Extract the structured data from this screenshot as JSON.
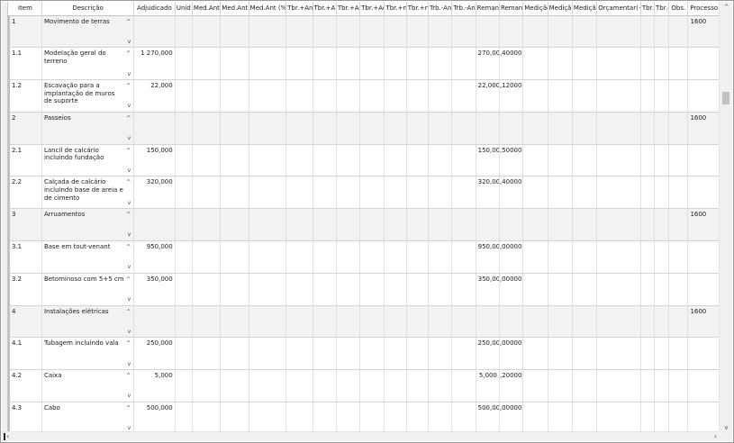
{
  "columns": [
    "Item",
    "Descrição",
    "Adjudicado",
    "Unid",
    "Med.Ant",
    "Med.Ant",
    "Med.Ant (%)",
    "Tbr.+Ant",
    "Tbr.+An",
    "Tbr.+Ad",
    "Tbr.+Ad",
    "Tbr.+n./",
    "Tbr.+n./",
    "Trb.-Ant",
    "Trb.-Ant",
    "Remane",
    "Remane",
    "Medição",
    "Medição",
    "Medição",
    "Orçamentar(+)",
    "Tbr.+",
    "Tbr.-",
    "Obs.",
    "Processo"
  ],
  "rows": [
    {
      "item": "1",
      "descricao": "Movimento de terras",
      "adjudicado": "",
      "remane1": "",
      "remane2": "",
      "processo": "1600",
      "group": true
    },
    {
      "item": "1.1",
      "descricao": "Modelação geral do terreno",
      "adjudicado": "1 270,000",
      "remane1": "270,000",
      "remane2": ",400000",
      "processo": "",
      "group": false
    },
    {
      "item": "1.2",
      "descricao": "Escavação para a implantação de muros de suporte",
      "adjudicado": "22,000",
      "remane1": "22,000",
      "remane2": ",120000",
      "processo": "",
      "group": false
    },
    {
      "item": "2",
      "descricao": "Passeios",
      "adjudicado": "",
      "remane1": "",
      "remane2": "",
      "processo": "1600",
      "group": true
    },
    {
      "item": "2.1",
      "descricao": "Lancil de calcário incluindo fundação",
      "adjudicado": "150,000",
      "remane1": "150,000",
      "remane2": ",500000",
      "processo": "",
      "group": false
    },
    {
      "item": "2.2",
      "descricao": "Calçada de calcário incluindo base de areia e de cimento",
      "adjudicado": "320,000",
      "remane1": "320,000",
      "remane2": ",400000",
      "processo": "",
      "group": false
    },
    {
      "item": "3",
      "descricao": "Arruamentos",
      "adjudicado": "",
      "remane1": "",
      "remane2": "",
      "processo": "1600",
      "group": true
    },
    {
      "item": "3.1",
      "descricao": "Base em tout-venant",
      "adjudicado": "950,000",
      "remane1": "950,000",
      "remane2": ",000000",
      "processo": "",
      "group": false
    },
    {
      "item": "3.2",
      "descricao": "Betominoso com 5+5 cm",
      "adjudicado": "350,000",
      "remane1": "350,000",
      "remane2": ",000000",
      "processo": "",
      "group": false
    },
    {
      "item": "4",
      "descricao": "Instalações elétricas",
      "adjudicado": "",
      "remane1": "",
      "remane2": "",
      "processo": "1600",
      "group": true
    },
    {
      "item": "4.1",
      "descricao": "Tubagem incluindo vala",
      "adjudicado": "250,000",
      "remane1": "250,000",
      "remane2": ",000000",
      "processo": "",
      "group": false
    },
    {
      "item": "4.2",
      "descricao": "Caixa",
      "adjudicado": "5,000",
      "remane1": "5,000",
      "remane2": ",200000",
      "processo": "",
      "group": false
    },
    {
      "item": "4.3",
      "descricao": "Cabo",
      "adjudicado": "500,000",
      "remane1": "500,000",
      "remane2": ",000000",
      "processo": "",
      "group": false
    }
  ],
  "icons": {
    "expand_up": "chevron-up-icon",
    "expand_down": "chevron-down-icon"
  },
  "colors": {
    "group_row": "#f2f2f2",
    "grid_line": "#d4d4d4"
  }
}
